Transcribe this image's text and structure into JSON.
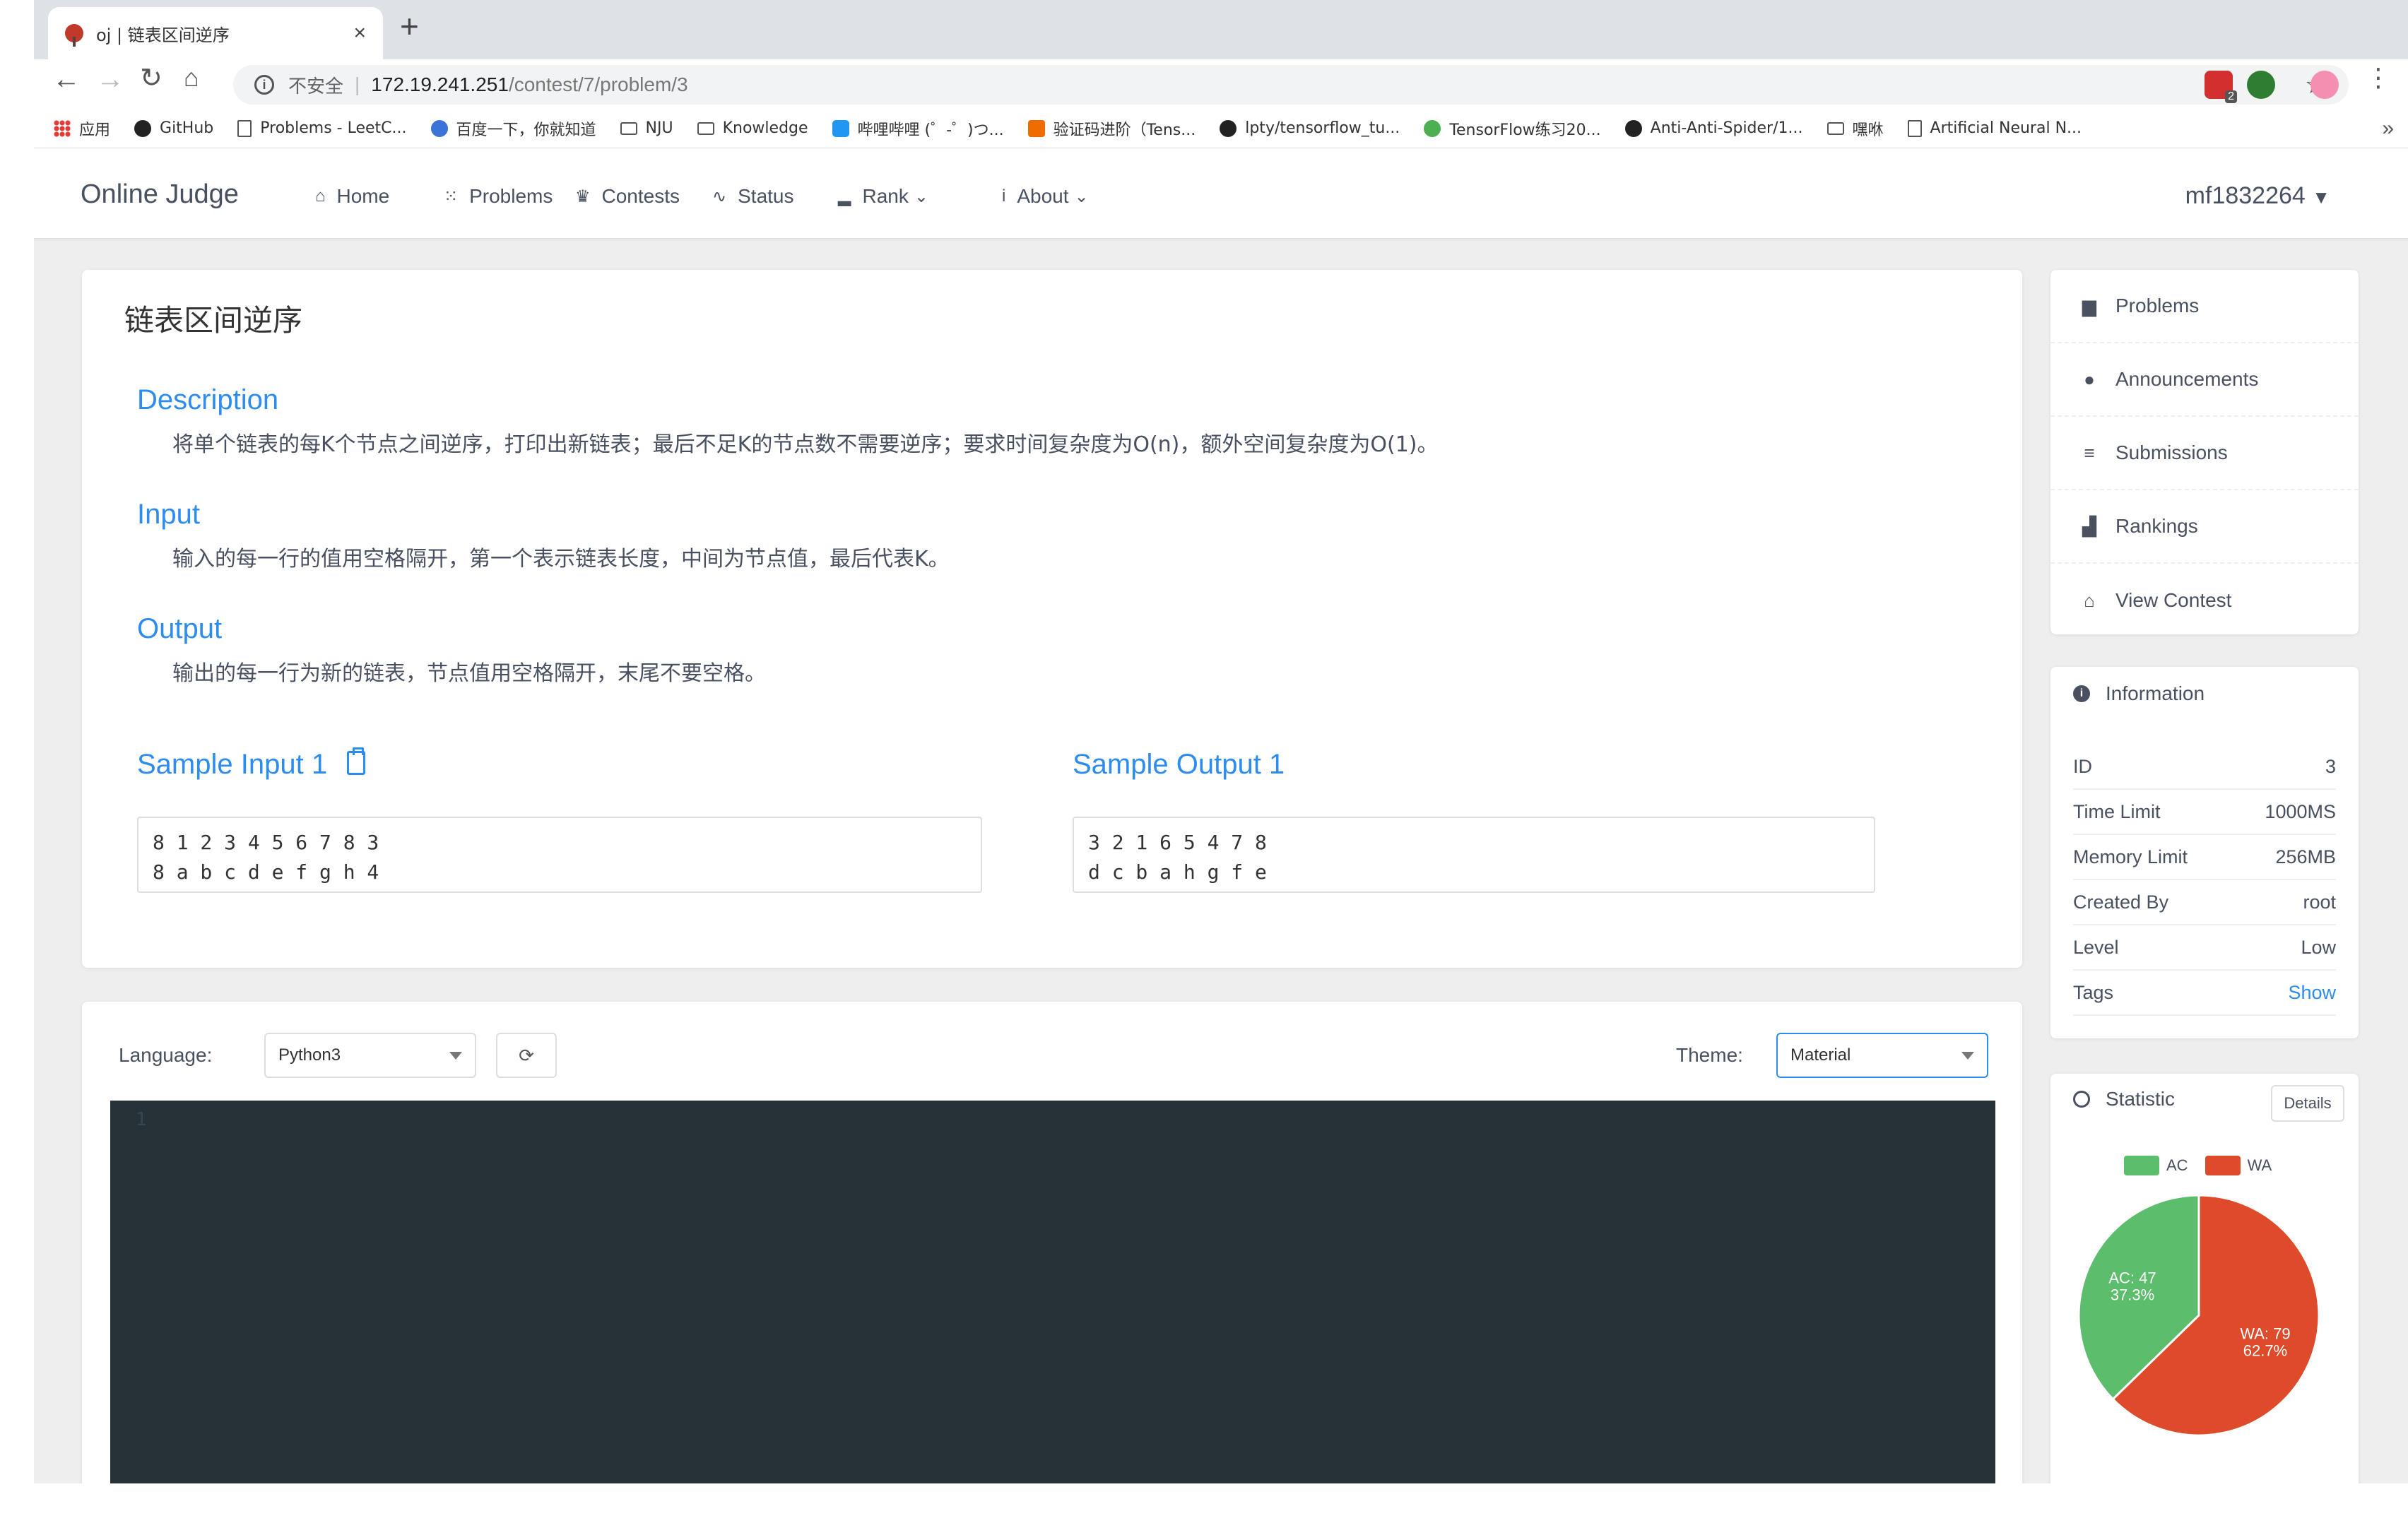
{
  "browser": {
    "tab_title": "oj | 链表区间逆序",
    "address_security": "不安全",
    "address_separator": "|",
    "address_host": "172.19.241.251",
    "address_path": "/contest/7/problem/3",
    "bookmarks": [
      {
        "icon": "apps-icon",
        "label": "应用"
      },
      {
        "icon": "github-icon",
        "label": "GitHub"
      },
      {
        "icon": "page-icon",
        "label": "Problems - LeetC..."
      },
      {
        "icon": "baidu-paw-icon",
        "label": "百度一下，你就知道"
      },
      {
        "icon": "folder-icon",
        "label": "NJU"
      },
      {
        "icon": "folder-icon",
        "label": "Knowledge"
      },
      {
        "icon": "bilibili-icon",
        "label": "哔哩哔哩 (゜-゜)つ..."
      },
      {
        "icon": "tf-icon",
        "label": "验证码进阶（Tens..."
      },
      {
        "icon": "github-icon",
        "label": "lpty/tensorflow_tu..."
      },
      {
        "icon": "snake-icon",
        "label": "TensorFlow练习20..."
      },
      {
        "icon": "github-icon",
        "label": "Anti-Anti-Spider/1..."
      },
      {
        "icon": "folder-icon",
        "label": "嘿咻"
      },
      {
        "icon": "page-icon",
        "label": "Artificial Neural N..."
      }
    ],
    "bookmarks_more": "»",
    "extension_badge": "2"
  },
  "header": {
    "logo": "Online Judge",
    "menu": [
      {
        "icon": "home-icon",
        "glyph": "⌂",
        "label": "Home",
        "dropdown": false
      },
      {
        "icon": "grid-icon",
        "glyph": "⁙",
        "label": "Problems",
        "dropdown": false
      },
      {
        "icon": "trophy-icon",
        "glyph": "♛",
        "label": "Contests",
        "dropdown": false
      },
      {
        "icon": "pulse-icon",
        "glyph": "∿",
        "label": "Status",
        "dropdown": false
      },
      {
        "icon": "bar-chart-icon",
        "glyph": "▂",
        "label": "Rank",
        "dropdown": true
      },
      {
        "icon": "info-icon",
        "glyph": "i",
        "label": "About",
        "dropdown": true
      }
    ],
    "user": "mf1832264"
  },
  "problem": {
    "title": "链表区间逆序",
    "description_title": "Description",
    "description": "将单个链表的每K个节点之间逆序，打印出新链表；最后不足K的节点数不需要逆序；要求时间复杂度为O(n)，额外空间复杂度为O(1)。",
    "input_title": "Input",
    "input": "输入的每一行的值用空格隔开，第一个表示链表长度，中间为节点值，最后代表K。",
    "output_title": "Output",
    "output": "输出的每一行为新的链表，节点值用空格隔开，末尾不要空格。",
    "sample_input_title": "Sample Input 1",
    "sample_input": "8 1 2 3 4 5 6 7 8 3\n8 a b c d e f g h 4",
    "sample_output_title": "Sample Output 1",
    "sample_output": "3 2 1 6 5 4 7 8\nd c b a h g f e"
  },
  "editor": {
    "language_label": "Language:",
    "language_value": "Python3",
    "theme_label": "Theme:",
    "theme_value": "Material",
    "line_number": "1"
  },
  "sidebar": {
    "nav": [
      {
        "icon": "book-icon",
        "glyph": "▆",
        "label": "Problems"
      },
      {
        "icon": "chat-icon",
        "glyph": "●",
        "label": "Announcements"
      },
      {
        "icon": "list-icon",
        "glyph": "≡",
        "label": "Submissions"
      },
      {
        "icon": "stats-icon",
        "glyph": "▟",
        "label": "Rankings"
      },
      {
        "icon": "home-icon",
        "glyph": "⌂",
        "label": "View Contest"
      }
    ],
    "info_title": "Information",
    "info": [
      {
        "key": "ID",
        "value": "3"
      },
      {
        "key": "Time Limit",
        "value": "1000MS"
      },
      {
        "key": "Memory Limit",
        "value": "256MB"
      },
      {
        "key": "Created By",
        "value": "root"
      },
      {
        "key": "Level",
        "value": "Low"
      },
      {
        "key": "Tags",
        "value": "Show"
      }
    ],
    "stat_title": "Statistic",
    "details_label": "Details"
  },
  "chart_data": {
    "type": "pie",
    "labels": [
      "AC",
      "WA"
    ],
    "values": [
      47,
      79
    ],
    "percent_labels": [
      "37.3%",
      "62.7%"
    ],
    "colors": [
      "#5cbd6c",
      "#de4b2b"
    ],
    "legend_position": "top"
  }
}
